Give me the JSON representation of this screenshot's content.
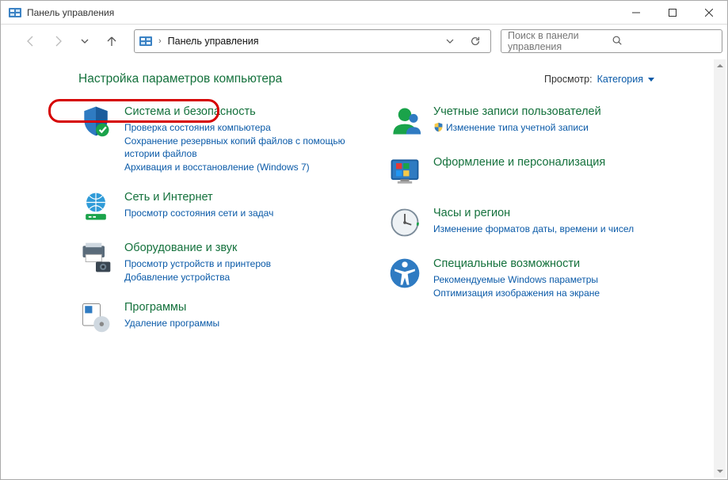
{
  "window": {
    "title": "Панель управления"
  },
  "address": {
    "crumb": "Панель управления"
  },
  "search": {
    "placeholder": "Поиск в панели управления"
  },
  "headline": "Настройка параметров компьютера",
  "view": {
    "label": "Просмотр:",
    "value": "Категория"
  },
  "left": [
    {
      "title": "Система и безопасность",
      "links": [
        "Проверка состояния компьютера",
        "Сохранение резервных копий файлов с помощью истории файлов",
        "Архивация и восстановление (Windows 7)"
      ]
    },
    {
      "title": "Сеть и Интернет",
      "links": [
        "Просмотр состояния сети и задач"
      ]
    },
    {
      "title": "Оборудование и звук",
      "links": [
        "Просмотр устройств и принтеров",
        "Добавление устройства"
      ]
    },
    {
      "title": "Программы",
      "links": [
        "Удаление программы"
      ]
    }
  ],
  "right": [
    {
      "title": "Учетные записи пользователей",
      "links": [
        "Изменение типа учетной записи"
      ],
      "shield": true
    },
    {
      "title": "Оформление и персонализация",
      "links": []
    },
    {
      "title": "Часы и регион",
      "links": [
        "Изменение форматов даты, времени и чисел"
      ]
    },
    {
      "title": "Специальные возможности",
      "links": [
        "Рекомендуемые Windows параметры",
        "Оптимизация изображения на экране"
      ]
    }
  ]
}
